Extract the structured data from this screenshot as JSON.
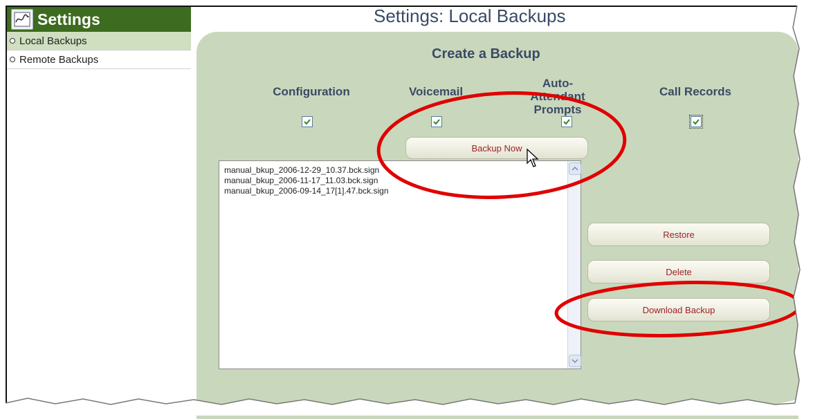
{
  "sidebar": {
    "title": "Settings",
    "items": [
      {
        "label": "Local Backups",
        "active": true
      },
      {
        "label": "Remote Backups",
        "active": false
      }
    ]
  },
  "page": {
    "title": "Settings: Local Backups"
  },
  "create_backup": {
    "title": "Create a Backup",
    "options": [
      {
        "label": "Configuration",
        "checked": true
      },
      {
        "label": "Voicemail",
        "checked": true
      },
      {
        "label": "Auto-Attendant Prompts",
        "checked": true
      },
      {
        "label": "Call Records",
        "checked": true
      }
    ],
    "backup_now_label": "Backup Now"
  },
  "backup_list": {
    "items": [
      "manual_bkup_2006-12-29_10.37.bck.sign",
      "manual_bkup_2006-11-17_11.03.bck.sign",
      "manual_bkup_2006-09-14_17[1].47.bck.sign"
    ]
  },
  "actions": {
    "restore_label": "Restore",
    "delete_label": "Delete",
    "download_label": "Download Backup"
  },
  "colors": {
    "sidebar_header": "#3d6b1f",
    "panel_bg": "#c9d8bc",
    "title_text": "#3a4a66",
    "button_text": "#9b2323",
    "annotation_red": "#e00000"
  },
  "icons": {
    "logo": "settings-logo-icon",
    "checkbox": "checkmark-icon",
    "scroll_up": "arrow-up-icon",
    "scroll_down": "arrow-down-icon",
    "cursor": "mouse-pointer-icon"
  }
}
